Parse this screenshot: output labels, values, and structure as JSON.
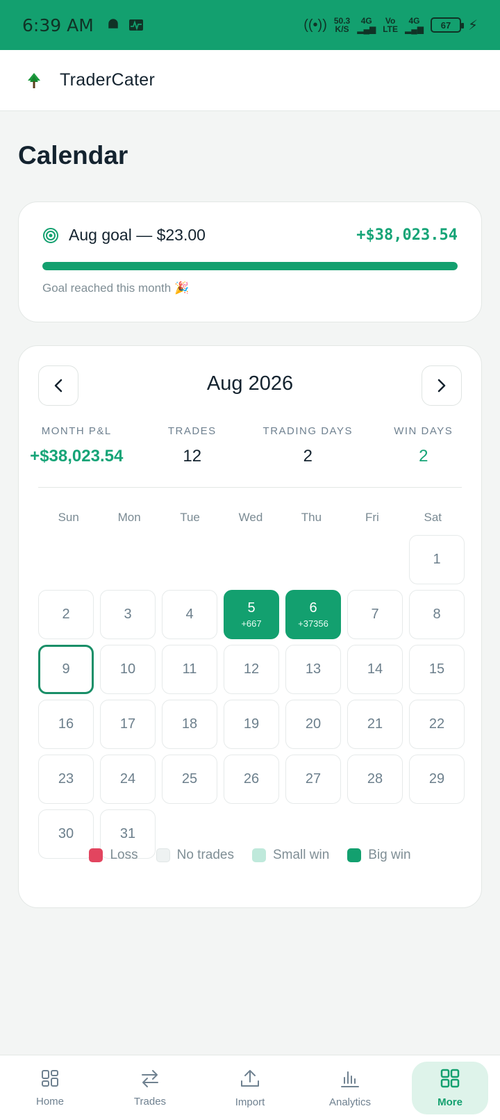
{
  "status_bar": {
    "time": "6:39 AM",
    "net_speed_top": "50.3",
    "net_speed_bottom": "K/S",
    "sim1": "4G",
    "volte_top": "Vo",
    "volte_bottom": "LTE",
    "sim2": "4G",
    "battery": "67"
  },
  "app": {
    "brand": "TraderCater"
  },
  "page": {
    "title": "Calendar"
  },
  "goal": {
    "label": "Aug goal — $23.00",
    "value": "+$38,023.54",
    "progress_fraction": 1.0,
    "note": "Goal reached this month 🎉"
  },
  "calendar": {
    "month_title": "Aug 2026",
    "stats": [
      {
        "label": "MONTH P&L",
        "value": "+$38,023.54"
      },
      {
        "label": "TRADES",
        "value": "12"
      },
      {
        "label": "TRADING DAYS",
        "value": "2"
      },
      {
        "label": "WIN DAYS",
        "value": "2"
      }
    ],
    "weekdays": [
      "Sun",
      "Mon",
      "Tue",
      "Wed",
      "Thu",
      "Fri",
      "Sat"
    ],
    "leading_empty_days": 6,
    "days": [
      {
        "d": "1"
      },
      {
        "d": "2"
      },
      {
        "d": "3"
      },
      {
        "d": "4"
      },
      {
        "d": "5",
        "pnl": "+667",
        "status": "big-win"
      },
      {
        "d": "6",
        "pnl": "+37356",
        "status": "big-win"
      },
      {
        "d": "7"
      },
      {
        "d": "8"
      },
      {
        "d": "9",
        "today": true
      },
      {
        "d": "10"
      },
      {
        "d": "11"
      },
      {
        "d": "12"
      },
      {
        "d": "13"
      },
      {
        "d": "14"
      },
      {
        "d": "15"
      },
      {
        "d": "16"
      },
      {
        "d": "17"
      },
      {
        "d": "18"
      },
      {
        "d": "19"
      },
      {
        "d": "20"
      },
      {
        "d": "21"
      },
      {
        "d": "22"
      },
      {
        "d": "23"
      },
      {
        "d": "24"
      },
      {
        "d": "25"
      },
      {
        "d": "26"
      },
      {
        "d": "27"
      },
      {
        "d": "28"
      },
      {
        "d": "29"
      },
      {
        "d": "30"
      },
      {
        "d": "31"
      }
    ],
    "legend": [
      {
        "label": "Loss",
        "color": "#e2455f"
      },
      {
        "label": "No trades",
        "color": "#eef2f2"
      },
      {
        "label": "Small win",
        "color": "#bfe9db"
      },
      {
        "label": "Big win",
        "color": "#13a06f"
      }
    ]
  },
  "bottom_nav": [
    {
      "label": "Home",
      "icon": "home-grid-icon"
    },
    {
      "label": "Trades",
      "icon": "swap-arrows-icon"
    },
    {
      "label": "Import",
      "icon": "upload-icon"
    },
    {
      "label": "Analytics",
      "icon": "bar-chart-icon"
    },
    {
      "label": "More",
      "icon": "more-grid-icon",
      "active": true
    }
  ],
  "colors": {
    "accent": "#13a06f",
    "positive": "#16a477"
  }
}
